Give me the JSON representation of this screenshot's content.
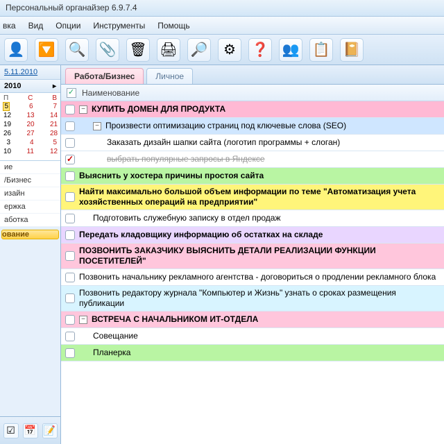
{
  "window_title": "Персональный органайзер 6.9.7.4",
  "menu": {
    "items": [
      "вка",
      "Вид",
      "Опции",
      "Инструменты",
      "Помощь"
    ]
  },
  "toolbar_icons": [
    "👤",
    "🔽",
    "🔍",
    "📎",
    "🗑",
    "🖨",
    "🔎",
    "⚙",
    "❓",
    "👥",
    "📋",
    "📔"
  ],
  "date_link": "5.11.2010",
  "cal": {
    "month": "2010",
    "weekdays": [
      "П",
      "С",
      "В"
    ],
    "rows": [
      [
        "5",
        "6",
        "7"
      ],
      [
        "12",
        "13",
        "14"
      ],
      [
        "19",
        "20",
        "21"
      ],
      [
        "26",
        "27",
        "28"
      ],
      [
        "3",
        "4",
        "5"
      ],
      [
        "10",
        "11",
        "12"
      ]
    ],
    "today": "5"
  },
  "categories": [
    "ие",
    "/Бизнес",
    "изайн",
    "ержка",
    "аботка"
  ],
  "selected_category": "ование",
  "bottom_icons": [
    "☑",
    "📅",
    "📝"
  ],
  "tabs": {
    "items": [
      "Работа/Бизнес",
      "Личное"
    ],
    "active": 0
  },
  "header_label": "Наименование",
  "tasks": [
    {
      "color": "c-pink2",
      "bold": true,
      "indent": 0,
      "ex": "-",
      "txt": "КУПИТЬ ДОМЕН ДЛЯ ПРОДУКТА"
    },
    {
      "color": "c-blue",
      "bold": false,
      "indent": 1,
      "ex": "-",
      "txt": "Произвести оптимизацию страниц под ключевые слова (SEO)"
    },
    {
      "color": "c-white",
      "bold": false,
      "indent": 2,
      "ex": "",
      "txt": "Заказать дизайн шапки сайта (логотип программы + слоган)"
    },
    {
      "color": "c-white",
      "bold": false,
      "indent": 2,
      "ex": "",
      "done": true,
      "strike": true,
      "txt": "выбрать популярные запросы в Яндексе"
    },
    {
      "color": "c-green",
      "bold": true,
      "indent": 0,
      "ex": "",
      "txt": "Выяснить у хостера причины простоя сайта"
    },
    {
      "color": "c-yellow",
      "bold": true,
      "indent": 0,
      "ex": "",
      "txt": "Найти максимально большой объем информации по теме \"Автоматизация учета хозяйственных операций на предприятии\""
    },
    {
      "color": "c-white",
      "bold": false,
      "indent": 1,
      "ex": "",
      "txt": "Подготовить служебную записку в отдел продаж"
    },
    {
      "color": "c-lav",
      "bold": true,
      "indent": 0,
      "ex": "",
      "txt": "Передать кладовщику информацию об остатках на складе"
    },
    {
      "color": "c-pink",
      "bold": true,
      "indent": 0,
      "ex": "",
      "txt": "ПОЗВОНИТЬ ЗАКАЗЧИКУ ВЫЯСНИТЬ ДЕТАЛИ РЕАЛИЗАЦИИ ФУНКЦИИ ПОСЕТИТЕЛЕЙ\""
    },
    {
      "color": "c-white",
      "bold": false,
      "indent": 0,
      "ex": "",
      "txt": "Позвонить начальнику рекламного агентства - договориться о продлении рекламного блока"
    },
    {
      "color": "c-ice",
      "bold": false,
      "indent": 0,
      "ex": "",
      "txt": "Позвонить редактору журнала \"Компьютер и Жизнь\" узнать о сроках размещения публикации"
    },
    {
      "color": "c-pink",
      "bold": true,
      "indent": 0,
      "ex": "-",
      "txt": "ВСТРЕЧА С НАЧАЛЬНИКОМ ИТ-ОТДЕЛА"
    },
    {
      "color": "c-white",
      "bold": false,
      "indent": 1,
      "ex": "",
      "txt": "Совещание"
    },
    {
      "color": "c-green",
      "bold": false,
      "indent": 1,
      "ex": "",
      "txt": "Планерка"
    }
  ]
}
